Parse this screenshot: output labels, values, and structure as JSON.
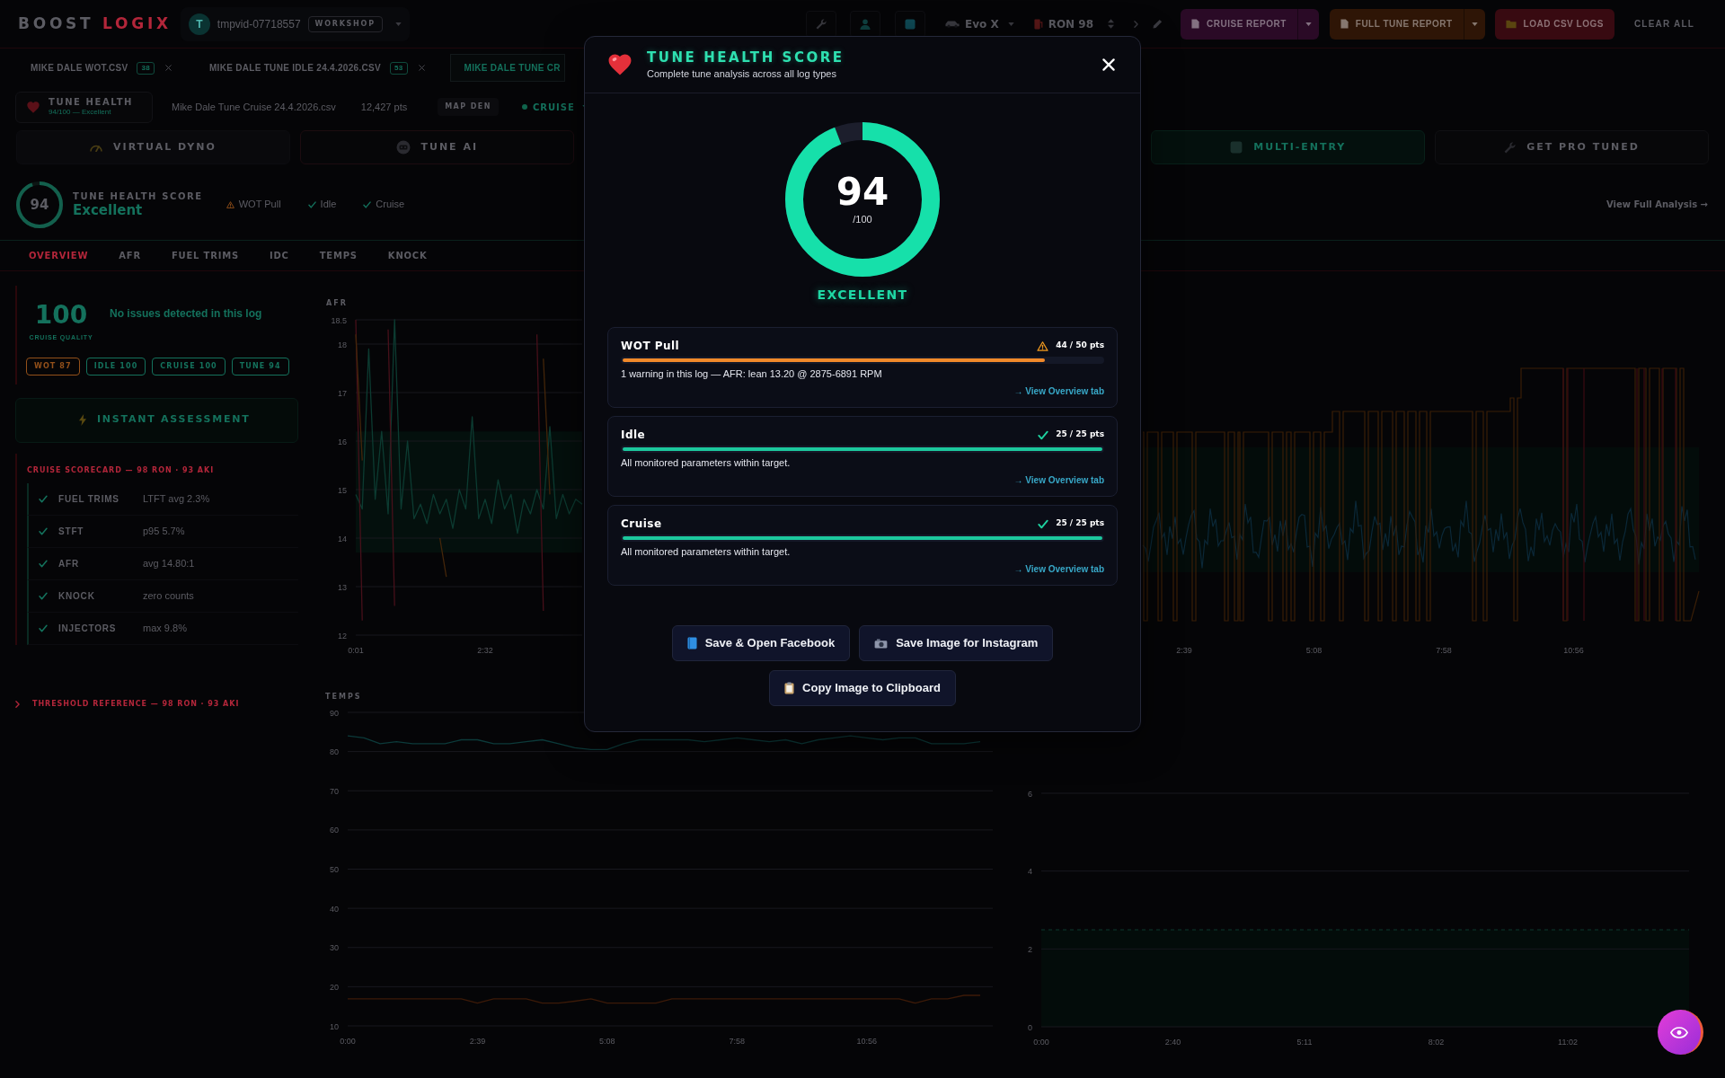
{
  "top_bar": {
    "logo": {
      "first": "BOOST",
      "second": "LOGIX"
    },
    "user": {
      "avatar": "T",
      "name": "tmpvid-07718557",
      "role": "WORKSHOP"
    },
    "vehicle": "Evo X",
    "fuel": "RON 98",
    "actions": [
      {
        "label": "CRUISE REPORT",
        "kind": "report",
        "color": "#2a0a26"
      },
      {
        "label": "FULL TUNE REPORT",
        "kind": "report",
        "color": "#2e1506"
      },
      {
        "label": "LOAD CSV LOGS",
        "kind": "load",
        "color": "#380a11"
      }
    ],
    "clear": "CLEAR ALL"
  },
  "file_tabs": [
    {
      "label": "MIKE DALE WOT.CSV",
      "badge": "38",
      "closable": true,
      "selected": false
    },
    {
      "label": "MIKE DALE TUNE IDLE 24.4.2026.CSV",
      "badge": "53",
      "closable": true,
      "selected": false
    },
    {
      "label": "MIKE DALE TUNE CR",
      "closable": false,
      "selected": true
    }
  ],
  "file_info": {
    "health": {
      "title": "TUNE HEALTH",
      "subtitle": "94/100 — Excellent"
    },
    "file_name": "Mike Dale Tune Cruise 24.4.2026.csv",
    "points": "12,427 pts",
    "map_badge": "MAP DEN",
    "mode": "CRUISE"
  },
  "feature_cards_left": [
    {
      "title": "VIRTUAL DYNO",
      "kind": "dyno"
    },
    {
      "title": "TUNE AI",
      "kind": "ai"
    }
  ],
  "feature_cards_right": [
    {
      "title": "MULTI-ENTRY",
      "kind": "multi"
    },
    {
      "title": "GET PRO TUNED",
      "kind": "pro"
    }
  ],
  "health_bar": {
    "score": "94",
    "level": 0.94,
    "title": "TUNE HEALTH SCORE",
    "rating": "Excellent",
    "logs": [
      {
        "label": "WOT Pull",
        "passed": false
      },
      {
        "label": "Idle",
        "passed": true
      },
      {
        "label": "Cruise",
        "passed": true
      }
    ],
    "link": "View Full Analysis →"
  },
  "view_tabs": [
    {
      "label": "OVERVIEW",
      "selected": true
    },
    {
      "label": "AFR",
      "selected": false
    },
    {
      "label": "FUEL TRIMS",
      "selected": false
    },
    {
      "label": "IDC",
      "selected": false
    },
    {
      "label": "TEMPS",
      "selected": false
    },
    {
      "label": "KNOCK",
      "selected": false
    }
  ],
  "summary": {
    "score": "100",
    "score_label": "CRUISE QUALITY",
    "headline": "No issues detected in this log",
    "chips": [
      {
        "label": "WOT 87",
        "color": "#93501a"
      },
      {
        "label": "IDLE 100",
        "color": "#14715c"
      },
      {
        "label": "CRUISE 100",
        "color": "#14715c"
      },
      {
        "label": "TUNE 94",
        "color": "#14715c"
      }
    ]
  },
  "assessment": {
    "title": "INSTANT ASSESSMENT"
  },
  "scorecard": {
    "title": "CRUISE SCORECARD — 98 RON · 93 AKI",
    "rows": [
      {
        "label": "FUEL TRIMS",
        "value": "LTFT avg 2.3%",
        "passed": true
      },
      {
        "label": "STFT",
        "value": "p95 5.7%",
        "passed": true
      },
      {
        "label": "AFR",
        "value": "avg 14.80:1",
        "passed": true
      },
      {
        "label": "KNOCK",
        "value": "zero counts",
        "passed": true
      },
      {
        "label": "INJECTORS",
        "value": "max 9.8%",
        "passed": true
      }
    ]
  },
  "reference": {
    "title": "THRESHOLD REFERENCE — 98 RON · 93 AKI",
    "expanded": false
  },
  "afr_chart": {
    "chart_data": {
      "type": "line",
      "title": "AFR",
      "grid": true,
      "categories": [
        "0:01",
        null,
        null,
        null,
        null,
        null,
        null,
        null,
        null,
        null,
        null,
        null,
        null,
        null,
        null,
        null,
        null,
        null,
        null,
        null,
        "2:32",
        null,
        null,
        null,
        null,
        null,
        null,
        null,
        null,
        null,
        null,
        null,
        null,
        null,
        null,
        null
      ],
      "ylim": [
        12,
        18.5
      ],
      "yticks": [
        12,
        13,
        14,
        15,
        16,
        17,
        18,
        18.5
      ],
      "series": [
        {
          "color": "#0c3b31",
          "values": [
            14.9,
            14.6,
            17.9,
            14.8,
            16.2,
            14.5,
            18.5,
            14.6,
            16.0,
            14.4,
            14.7,
            14.3,
            14.9,
            14.5,
            14.8,
            14.2,
            15.0,
            14.6,
            16.5,
            14.4,
            14.8,
            14.3,
            15.2,
            14.6,
            14.9,
            14.1,
            14.8,
            14.5,
            15.0,
            14.6,
            16.3,
            14.4,
            14.9,
            14.5,
            14.8,
            14.7
          ]
        },
        {
          "color": "#47101a",
          "values": [
            18.5,
            12.3,
            null,
            null,
            null,
            18.3,
            12.6,
            null,
            null,
            null,
            null,
            null,
            null,
            null,
            null,
            null,
            null,
            null,
            null,
            null,
            null,
            null,
            null,
            null,
            null,
            null,
            null,
            null,
            18.2,
            12.5,
            null,
            null,
            null,
            null,
            null,
            null
          ]
        },
        {
          "color": "#44260a",
          "values": [
            18.2,
            15.6,
            null,
            null,
            null,
            null,
            null,
            null,
            null,
            null,
            null,
            null,
            null,
            14.0,
            13.2,
            null,
            null,
            null,
            null,
            null,
            null,
            null,
            null,
            null,
            null,
            null,
            null,
            null,
            null,
            17.7,
            14.9,
            null,
            null,
            null,
            null,
            null
          ]
        }
      ],
      "bands": [
        {
          "axis": "y",
          "from": 13.7,
          "to": 16.2
        }
      ]
    }
  },
  "chart_top_right": {
    "x_labels": [
      "2:39",
      "5:08",
      "7:58",
      "10:56"
    ]
  },
  "temps_chart": {
    "chart_data": {
      "type": "line",
      "title": "TEMPS",
      "grid": true,
      "categories": [
        "0:00",
        null,
        null,
        null,
        null,
        null,
        null,
        null,
        "2:39",
        null,
        null,
        null,
        null,
        null,
        null,
        null,
        "5:08",
        null,
        null,
        null,
        null,
        null,
        null,
        null,
        "7:58",
        null,
        null,
        null,
        null,
        null,
        null,
        null,
        "10:56",
        null,
        null,
        null,
        null,
        null,
        null,
        null
      ],
      "ylim": [
        10,
        90
      ],
      "yticks": [
        10,
        20,
        30,
        40,
        50,
        60,
        70,
        80,
        90
      ],
      "series": [
        {
          "color": "#0c3a3a",
          "values": [
            84,
            83.5,
            82,
            82.5,
            82,
            82,
            82,
            83,
            83,
            82,
            82,
            82.5,
            83,
            82,
            81,
            80.5,
            80.5,
            82,
            83,
            83,
            83,
            83,
            82.5,
            83,
            83.5,
            83,
            82.5,
            83,
            82,
            83,
            83.5,
            84,
            83.5,
            83,
            83.5,
            83.5,
            82,
            82,
            82,
            82.5
          ]
        },
        {
          "color": "#3c1a08",
          "values": [
            16.9,
            16.9,
            16.9,
            16.9,
            16.9,
            16.9,
            16.9,
            16.9,
            15.8,
            16.9,
            16.9,
            16.9,
            15.8,
            15.8,
            16.3,
            16.9,
            15.8,
            15.8,
            15.8,
            15.8,
            16.9,
            16.9,
            16.9,
            16.9,
            16.9,
            16.9,
            16.9,
            16.9,
            16.9,
            16.9,
            16.9,
            16.9,
            16.9,
            16.9,
            16.9,
            15.8,
            16.9,
            16.9,
            17.8,
            17.8
          ]
        }
      ]
    }
  },
  "chart_bottom_right": {
    "y_labels": [
      "6",
      "4",
      "2",
      "0"
    ],
    "x_labels": [
      "0:00",
      "2:40",
      "5:11",
      "8:02",
      "11:02"
    ]
  },
  "modal": {
    "title": "TUNE HEALTH SCORE",
    "subtitle": "Complete tune analysis across all log types",
    "score": "94",
    "max": "/100",
    "level": 0.94,
    "rating": "EXCELLENT",
    "logs": [
      {
        "name": "WOT Pull",
        "passed": false,
        "points": "44 / 50 pts",
        "level": 0.88,
        "message": "1 warning in this log — AFR: lean 13.20 @ 2875-6891 RPM",
        "link": "→ View Overview tab"
      },
      {
        "name": "Idle",
        "passed": true,
        "points": "25 / 25 pts",
        "level": 1,
        "message": "All monitored parameters within target.",
        "link": "→ View Overview tab"
      },
      {
        "name": "Cruise",
        "passed": true,
        "points": "25 / 25 pts",
        "level": 1,
        "message": "All monitored parameters within target.",
        "link": "→ View Overview tab"
      }
    ],
    "share_buttons": [
      {
        "label": "Save & Open Facebook",
        "kind": "book"
      },
      {
        "label": "Save Image for Instagram",
        "kind": "camera"
      },
      {
        "label": "Copy Image to Clipboard",
        "kind": "clipboard"
      }
    ]
  }
}
